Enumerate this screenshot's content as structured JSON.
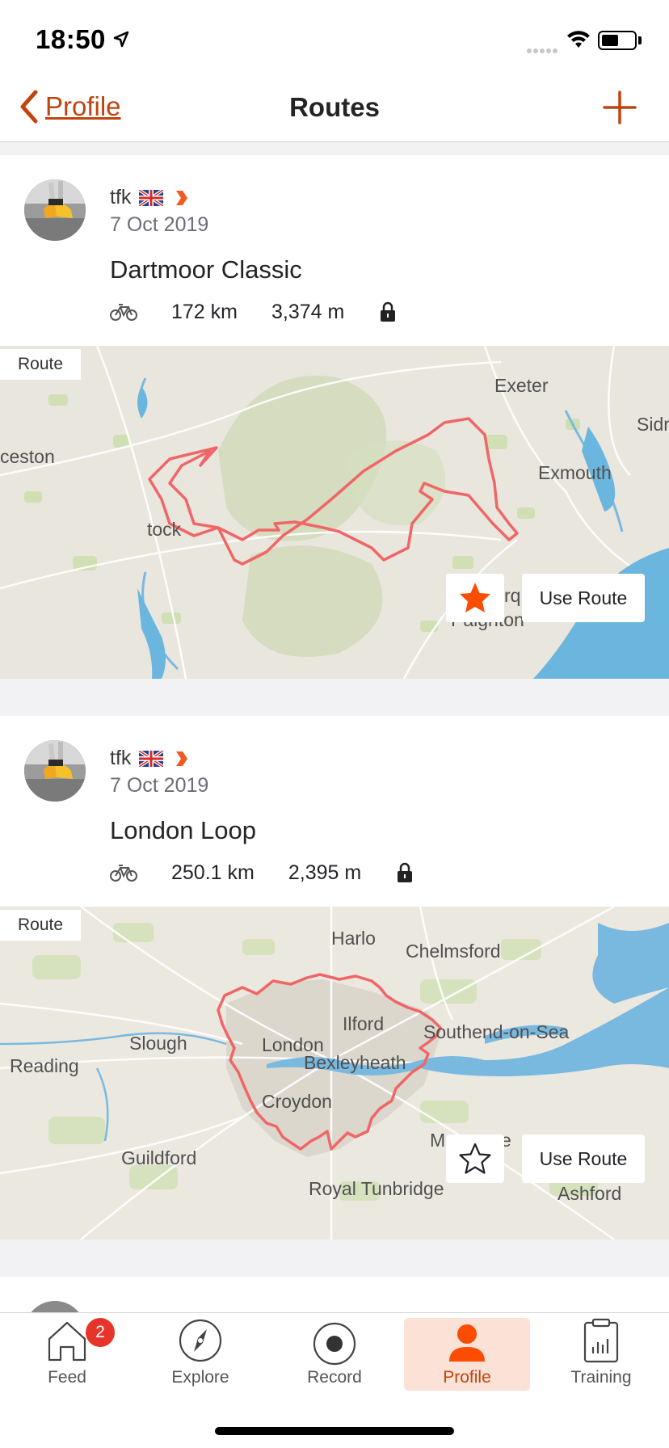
{
  "status_bar": {
    "time": "18:50"
  },
  "nav": {
    "back_label": "Profile",
    "title": "Routes"
  },
  "colors": {
    "accent": "#c1440e",
    "route_line": "#f06666",
    "water": "#66b3dd",
    "star_fill": "#fc4c02"
  },
  "routes": [
    {
      "athlete": "tfk",
      "date": "7 Oct 2019",
      "name": "Dartmoor Classic",
      "distance": "172 km",
      "elevation": "3,374 m",
      "map_label": "Route",
      "starred": true,
      "use_route_label": "Use Route",
      "places": [
        "Exeter",
        "Sidr",
        "ceston",
        "Exmouth",
        "tock",
        "rq",
        "Paignton"
      ]
    },
    {
      "athlete": "tfk",
      "date": "7 Oct 2019",
      "name": "London Loop",
      "distance": "250.1 km",
      "elevation": "2,395 m",
      "map_label": "Route",
      "starred": false,
      "use_route_label": "Use Route",
      "places": [
        "Harlo",
        "Chelmsford",
        "Ilford",
        "Southend-on-Sea",
        "London",
        "Slough",
        "Reading",
        "Bexleyheath",
        "Croydon",
        "Ma",
        "e",
        "Guildford",
        "Royal Tunbridge",
        "Ashford"
      ]
    }
  ],
  "tabs": [
    {
      "label": "Feed",
      "badge": "2"
    },
    {
      "label": "Explore"
    },
    {
      "label": "Record"
    },
    {
      "label": "Profile",
      "active": true
    },
    {
      "label": "Training"
    }
  ]
}
